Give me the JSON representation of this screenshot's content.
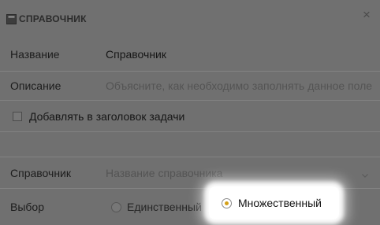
{
  "header": {
    "title": "СПРАВОЧНИК",
    "close_symbol": "×"
  },
  "fields": {
    "name": {
      "label": "Название",
      "value": "Справочник"
    },
    "description": {
      "label": "Описание",
      "placeholder": "Объясните, как необходимо заполнять данное поле"
    },
    "add_to_title": {
      "label": "Добавлять в заголовок задачи",
      "checked": false
    },
    "directory": {
      "label": "Справочник",
      "placeholder": "Название справочника"
    },
    "choice": {
      "label": "Выбор",
      "options": [
        {
          "label": "Единственный",
          "selected": false
        },
        {
          "label": "Множественный",
          "selected": true
        }
      ]
    }
  },
  "colors": {
    "overlay": "#707070",
    "selected_dot": "#d4a017",
    "highlight": "#ffffff"
  },
  "icons": {
    "header": "book-icon",
    "close": "close-icon",
    "directory": "chevron-down-icon"
  }
}
